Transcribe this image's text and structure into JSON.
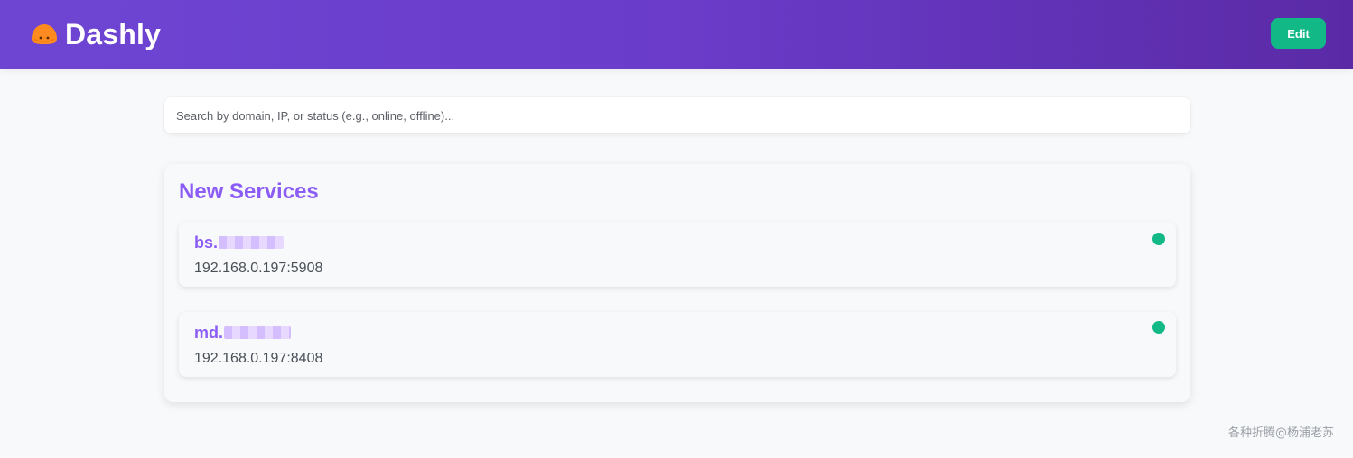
{
  "header": {
    "brand_name": "Dashly",
    "logo_icon": "mushroom-logo-icon",
    "edit_label": "Edit"
  },
  "search": {
    "placeholder": "Search by domain, IP, or status (e.g., online, offline)...",
    "value": ""
  },
  "section": {
    "title": "New Services",
    "services": [
      {
        "name_prefix": "bs.",
        "address": "192.168.0.197:5908",
        "status": "online"
      },
      {
        "name_prefix": "md.",
        "address": "192.168.0.197:8408",
        "status": "online"
      }
    ]
  },
  "colors": {
    "accent": "#8b5cf6",
    "header_gradient_start": "#6e45d3",
    "header_gradient_end": "#5a2aa6",
    "online": "#12b886",
    "edit_button": "#12b886"
  },
  "watermark": "各种折腾@杨浦老苏"
}
